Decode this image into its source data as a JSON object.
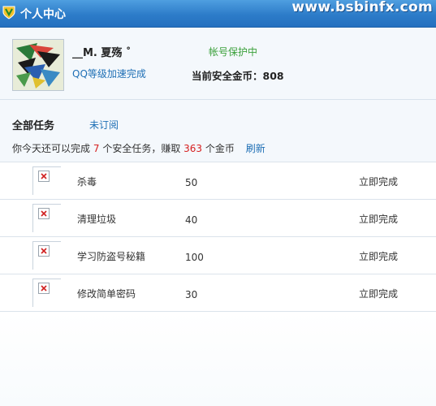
{
  "titlebar": {
    "title": "个人中心",
    "logo_icon": "shield-v-icon",
    "watermark": "www.bsbinfx.com"
  },
  "profile": {
    "avatar_icon": "paper-crane-avatar",
    "nickname": "__M. 夏殇 ˚",
    "vip_link": "QQ等级加速完成",
    "protect_status": "帐号保护中",
    "coins_label": "当前安全金币：808"
  },
  "tasks": {
    "title": "全部任务",
    "subscribe_link": "未订阅",
    "summary_prefix": "你今天还可以完成",
    "remaining_count": "7",
    "summary_middle": "个安全任务，赚取",
    "earnable_coins": "363",
    "summary_suffix": "个金币",
    "refresh_link": "刷新",
    "items": [
      {
        "name": "杀毒",
        "points": "50",
        "action": "立即完成"
      },
      {
        "name": "清理垃圾",
        "points": "40",
        "action": "立即完成"
      },
      {
        "name": "学习防盗号秘籍",
        "points": "100",
        "action": "立即完成"
      },
      {
        "name": "修改简单密码",
        "points": "30",
        "action": "立即完成"
      }
    ]
  },
  "colors": {
    "titlebar": "#2d7cc9",
    "link": "#1e6fb5",
    "protect_green": "#3aa03a",
    "highlight_red": "#d62020"
  }
}
